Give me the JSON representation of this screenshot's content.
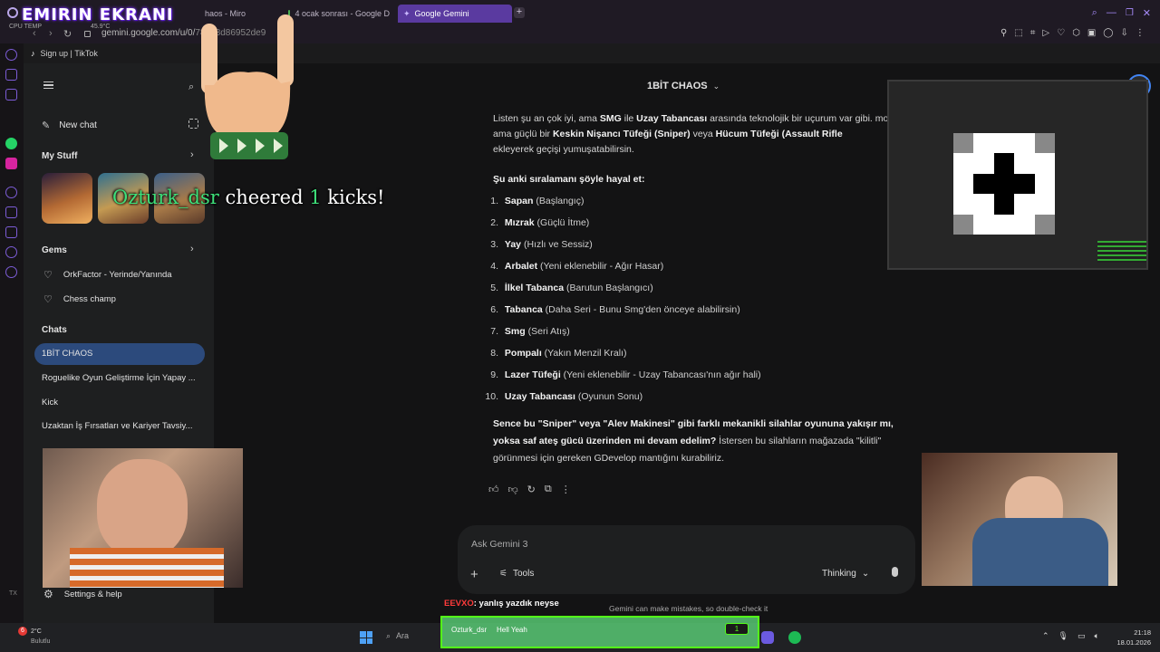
{
  "overlay": {
    "title": "EMIRIN EKRANI",
    "cheer_user": "Ozturk_dsr",
    "cheer_middle": "cheered",
    "cheer_count": "1",
    "cheer_end": "kicks!",
    "chat_user": "EEVXO",
    "chat_message": ": yanlış yazdık neyse",
    "banner_user": "Ozturk_dsr",
    "banner_text": "Hell Yeah",
    "banner_count": "1"
  },
  "browser": {
    "tabs": [
      {
        "label": "haos - Miro"
      },
      {
        "label": "4 ocak sonrası - Google D"
      },
      {
        "label": "Google Gemini"
      }
    ],
    "cpu_label": "CPU TEMP",
    "cpu_value": "45.9°C",
    "url": "gemini.google.com/u/0/",
    "url_rest": "78078d86952de9",
    "bookmark": "Sign up | TikTok"
  },
  "sidebar": {
    "new_chat": "New chat",
    "my_stuff": "My Stuff",
    "gems_title": "Gems",
    "gems": [
      "OrkFactor - Yerinde/Yanında",
      "Chess champ"
    ],
    "chats_title": "Chats",
    "chats": [
      "1BİT CHAOS",
      "Roguelike Oyun Geliştirme İçin Yapay ...",
      "Kick",
      "Uzaktan İş Fırsatları ve Kariyer Tavsiy..."
    ],
    "settings": "Settings & help"
  },
  "main": {
    "title": "1BİT CHAOS",
    "intro": {
      "a": "Listen şu an çok iyi, ama ",
      "b": "SMG",
      "c": " ile ",
      "d": "Uzay Tabancası",
      "e": " arasında teknolojik bir uçurum var gibi. ",
      "f": "modern ama güçlü bir ",
      "g": "Keskin Nişancı Tüfeği (Sniper)",
      "h": " veya ",
      "i": "Hücum Tüfeği (Assault Rifle",
      "j": "ekleyerek geçişi yumuşatabilirsin."
    },
    "list_heading": "Şu anki sıralamanı şöyle hayal et:",
    "list": [
      {
        "num": "1.",
        "name": "Sapan",
        "desc": " (Başlangıç)"
      },
      {
        "num": "2.",
        "name": "Mızrak",
        "desc": " (Güçlü İtme)"
      },
      {
        "num": "3.",
        "name": "Yay",
        "desc": " (Hızlı ve Sessiz)"
      },
      {
        "num": "4.",
        "name": "Arbalet",
        "desc": " (Yeni eklenebilir - Ağır Hasar)"
      },
      {
        "num": "5.",
        "name": "İlkel Tabanca",
        "desc": " (Barutun Başlangıcı)"
      },
      {
        "num": "6.",
        "name": "Tabanca",
        "desc": " (Daha Seri - Bunu Smg'den önceye alabilirsin)"
      },
      {
        "num": "7.",
        "name": "Smg",
        "desc": " (Seri Atış)"
      },
      {
        "num": "8.",
        "name": "Pompalı",
        "desc": " (Yakın Menzil Kralı)"
      },
      {
        "num": "9.",
        "name": "Lazer Tüfeği",
        "desc": " (Yeni eklenebilir - Uzay Tabancası'nın ağır hali)"
      },
      {
        "num": "10.",
        "name": "Uzay Tabancası",
        "desc": " (Oyunun Sonu)"
      }
    ],
    "outro": {
      "a": "Sence bu \"Sniper\" veya \"Alev Makinesi\" gibi farklı mekanikli silahlar oyununa yakışır mı, yoksa saf ateş gücü üzerinden mi devam edelim?",
      "b": " İstersen bu silahların mağazada \"kilitli\" görünmesi için gereken GDevelop mantığını kurabiliriz."
    },
    "input_placeholder": "Ask Gemini 3",
    "tools": "Tools",
    "mode": "Thinking",
    "disclaimer": "Gemini can make mistakes, so double-check it"
  },
  "taskbar": {
    "weather_temp": "2°C",
    "weather_desc": "Bulutlu",
    "notif": "6",
    "search": "Ara",
    "time": "21:18",
    "date": "18.01.2026"
  },
  "misc": {
    "tx_label": "TX"
  },
  "colors": {
    "accent": "#5a3aa0",
    "active_chat": "#2c4a7c",
    "cheer_green": "#3ee07a",
    "chat_user": "#ff3b3b"
  }
}
